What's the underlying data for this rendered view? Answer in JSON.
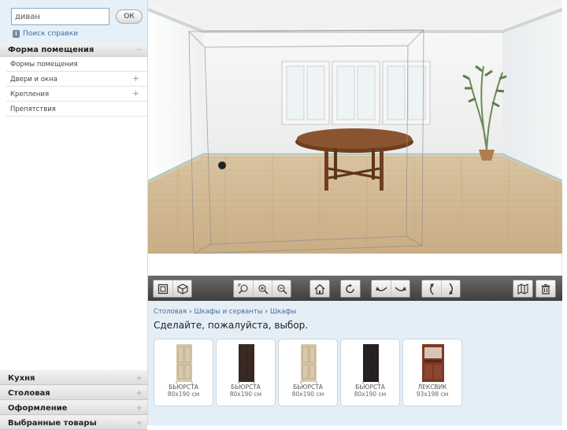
{
  "search": {
    "value": "диван",
    "ok_label": "ОК",
    "help_link": "Поиск справки"
  },
  "room_shape": {
    "header": "Форма помещения",
    "items": [
      {
        "label": "Формы помещения",
        "expandable": false
      },
      {
        "label": "Двери и окна",
        "expandable": true
      },
      {
        "label": "Крепления",
        "expandable": true
      },
      {
        "label": "Препятствия",
        "expandable": false
      }
    ]
  },
  "bottom_sections": [
    {
      "label": "Кухня"
    },
    {
      "label": "Столовая"
    },
    {
      "label": "Оформление"
    },
    {
      "label": "Выбранные товары"
    }
  ],
  "toolbar_icons": [
    "view-2d-icon",
    "view-3d-icon",
    "zoom-fit-icon",
    "zoom-in-icon",
    "zoom-out-icon",
    "home-icon",
    "reset-icon",
    "rotate-left-icon",
    "rotate-right-icon",
    "tilt-up-icon",
    "tilt-down-icon",
    "catalog-icon",
    "trash-icon"
  ],
  "breadcrumb": [
    "Столовая",
    "Шкафы и серванты",
    "Шкафы"
  ],
  "prompt": "Сделайте, пожалуйста, выбор.",
  "products": [
    {
      "name": "БЬЮРСТА",
      "dims": "80x190 см",
      "color": "#d9c9a8"
    },
    {
      "name": "БЬЮРСТА",
      "dims": "80x190 см",
      "color": "#3a2a22"
    },
    {
      "name": "БЬЮРСТА",
      "dims": "80x190 см",
      "color": "#d9c9a8"
    },
    {
      "name": "БЬЮРСТА",
      "dims": "80x190 см",
      "color": "#2a2222"
    },
    {
      "name": "ЛЕКСВИК",
      "dims": "93x198 см",
      "color": "#7a3a26"
    }
  ]
}
